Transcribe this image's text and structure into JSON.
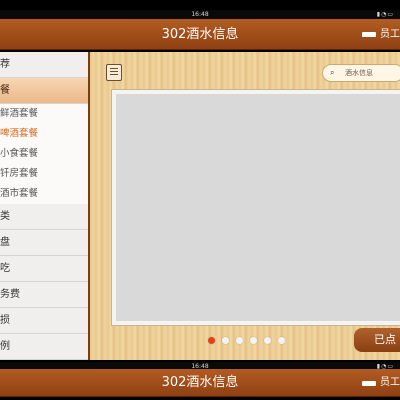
{
  "status_bar": {
    "time": "16:48",
    "icons": [
      "signal-icon",
      "wifi-icon",
      "battery-icon"
    ]
  },
  "title_bar": {
    "title": "302酒水信息",
    "user_label": "员工"
  },
  "sidebar": {
    "items_before": [
      {
        "label": "荐"
      },
      {
        "label": "餐"
      }
    ],
    "sub_items": [
      {
        "label": "鲜酒套餐"
      },
      {
        "label": "啤酒套餐"
      },
      {
        "label": "小食套餐"
      },
      {
        "label": "钎房套餐"
      },
      {
        "label": "酒市套餐"
      }
    ],
    "items_after": [
      {
        "label": "类"
      },
      {
        "label": "盘"
      },
      {
        "label": "吃"
      },
      {
        "label": "务费"
      },
      {
        "label": "损"
      },
      {
        "label": "例"
      }
    ]
  },
  "main": {
    "search_placeholder": "酒水信息",
    "pager": {
      "total": 6,
      "current": 1
    },
    "ordered_button": "已点"
  },
  "bottom_status_bar": {
    "time": "16:48"
  },
  "bottom_title_bar": {
    "title": "302酒水信息",
    "user_label": "员工"
  },
  "colors": {
    "title_bar": "#a44f1b",
    "accent": "#d66a1e",
    "active_dot": "#e0401a"
  }
}
